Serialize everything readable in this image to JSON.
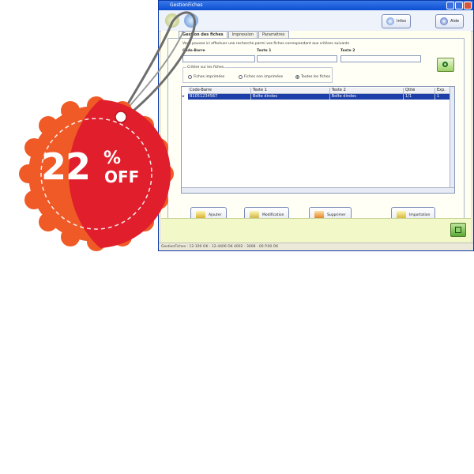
{
  "window": {
    "title": "GestionFiches",
    "toolbar": {
      "info_label": "Infos",
      "help_label": "Aide"
    },
    "tabs": [
      {
        "label": "Gestion des fiches"
      },
      {
        "label": "Impression"
      },
      {
        "label": "Paramètres"
      }
    ],
    "panel": {
      "help_text": "Vous pouvez ici effectuer une recherche parmi vos fiches correspondant aux critères suivants",
      "fields": [
        {
          "label": "Code-Barre",
          "value": ""
        },
        {
          "label": "Texte 1",
          "value": ""
        },
        {
          "label": "Texte 2",
          "value": ""
        }
      ],
      "filter": {
        "title": "Critère sur les fiches",
        "options": [
          {
            "label": "Fiches imprimées",
            "selected": false
          },
          {
            "label": "Fiches non imprimées",
            "selected": false
          },
          {
            "label": "Toutes les fiches",
            "selected": true
          }
        ]
      },
      "table": {
        "columns": [
          "Code-Barre",
          "Texte 1",
          "Texte 2",
          "Qtité",
          "Exp."
        ],
        "rows": [
          [
            "B1051234567",
            "Boîte dindes",
            "Boîte dindes",
            "1/1",
            "1"
          ]
        ]
      },
      "actions": {
        "add_label": "Ajouter",
        "edit_label": "Modification",
        "delete_label": "Supprimer",
        "import_label": "Importation"
      }
    },
    "status_text": "GestionFiches : 12-190 OK - 12-4406 OK 4002 - 3008 - 00 P.00 OK"
  },
  "promo": {
    "discount_value": "22",
    "discount_symbol": "%",
    "discount_suffix": "OFF"
  },
  "colors": {
    "tag_red": "#e01e2c",
    "tag_orange": "#ef5a26",
    "selection_blue": "#1c3ea8",
    "footer_yellow": "#f3f8c9"
  }
}
